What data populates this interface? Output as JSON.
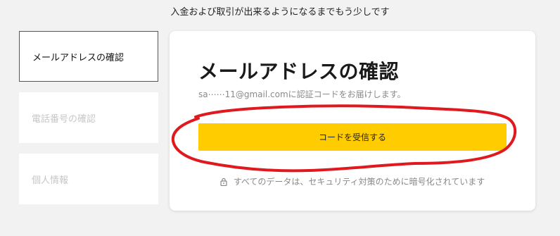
{
  "page": {
    "top_note": "入金および取引が出来るようになるまでもう少しです"
  },
  "steps": [
    {
      "label": "メールアドレスの確認",
      "active": true
    },
    {
      "label": "電話番号の確認",
      "active": false
    },
    {
      "label": "個人情報",
      "active": false
    }
  ],
  "card": {
    "title": "メールアドレスの確認",
    "subtitle": "sa⋯⋯11@gmail.comに認証コードをお届けします。",
    "button_label": "コードを受信する",
    "security_note": "すべてのデータは、セキュリティ対策のために暗号化されています"
  },
  "icons": {
    "security": "lock-icon"
  },
  "colors": {
    "primary_button": "#ffcc00",
    "annotation_circle": "#e0191f"
  }
}
